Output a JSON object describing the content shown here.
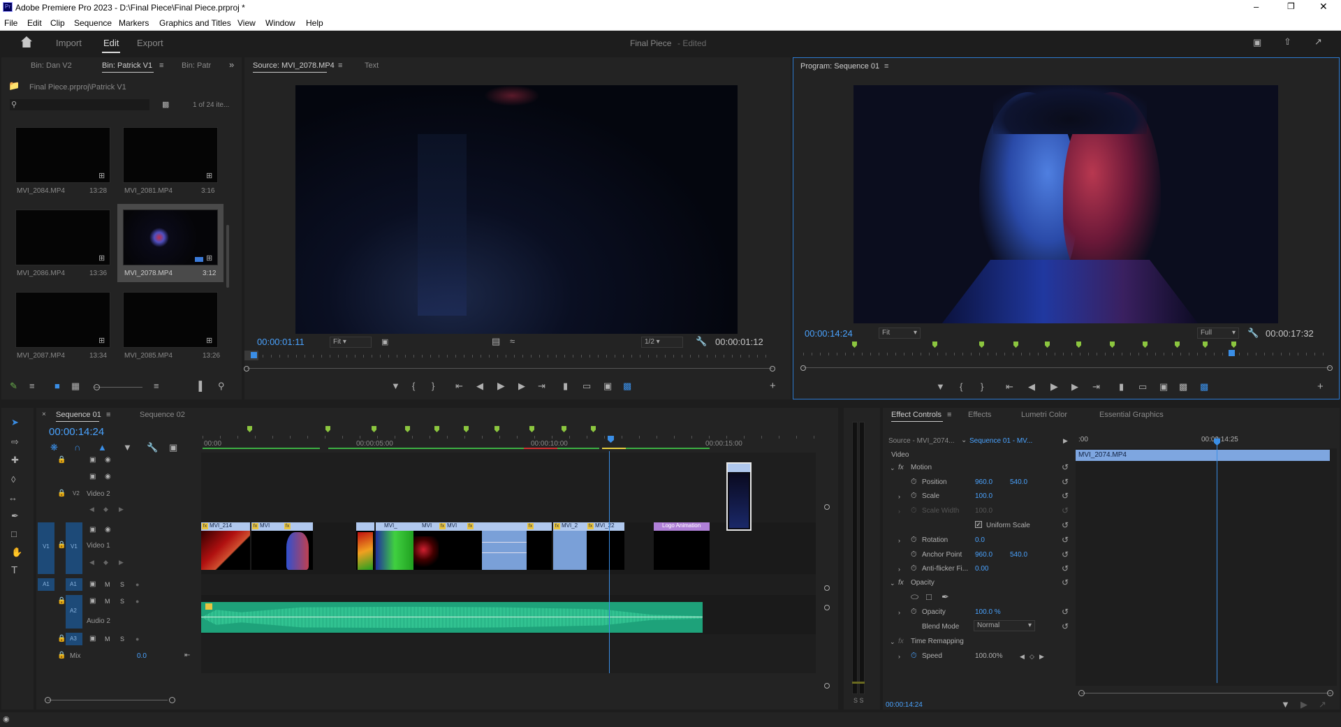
{
  "window": {
    "title": "Adobe Premiere Pro 2023 - D:\\Final Piece\\Final Piece.prproj *"
  },
  "menu": [
    "File",
    "Edit",
    "Clip",
    "Sequence",
    "Markers",
    "Graphics and Titles",
    "View",
    "Window",
    "Help"
  ],
  "workspace": {
    "tabs": [
      "Import",
      "Edit",
      "Export"
    ],
    "active": "Edit",
    "project_title": "Final Piece",
    "project_status": "- Edited"
  },
  "project_panel": {
    "tabs": [
      "Bin: Dan V2",
      "Bin: Patrick V1",
      "Bin: Patr"
    ],
    "path": "Final Piece.prproj\\Patrick V1",
    "count": "1 of 24 ite...",
    "items": [
      {
        "name": "MVI_2084.MP4",
        "duration": "13:28"
      },
      {
        "name": "MVI_2081.MP4",
        "duration": "3:16"
      },
      {
        "name": "MVI_2086.MP4",
        "duration": "13:36"
      },
      {
        "name": "MVI_2078.MP4",
        "duration": "3:12"
      },
      {
        "name": "MVI_2087.MP4",
        "duration": "13:34"
      },
      {
        "name": "MVI_2085.MP4",
        "duration": "13:26"
      }
    ]
  },
  "source_monitor": {
    "tabs": [
      "Source: MVI_2078.MP4",
      "Text"
    ],
    "timecode": "00:00:01:11",
    "fit": "Fit",
    "resolution": "1/2",
    "duration": "00:00:01:12"
  },
  "program_monitor": {
    "tab": "Program: Sequence 01",
    "timecode": "00:00:14:24",
    "fit": "Fit",
    "resolution": "Full",
    "duration": "00:00:17:32"
  },
  "timeline": {
    "tabs": [
      "Sequence 01",
      "Sequence 02"
    ],
    "timecode": "00:00:14:24",
    "ruler": [
      "00:00",
      "00:00:05:00",
      "00:00:10:00",
      "00:00:15:00"
    ],
    "tracks": {
      "v3": "V3",
      "v2": "V2",
      "v2_name": "Video 2",
      "v1": "V1",
      "v1_name": "Video 1",
      "a1": "A1",
      "a2": "A2",
      "a2_name": "Audio 2",
      "a3": "A3",
      "mix": "Mix",
      "mix_val": "0.0"
    },
    "clips": [
      "MVI_214",
      "MVI",
      "MVI_",
      "MVI",
      "MVI",
      "MVI_2",
      "MVI_22",
      "Logo Animation"
    ]
  },
  "effect_controls": {
    "tabs": [
      "Effect Controls",
      "Effects",
      "Lumetri Color",
      "Essential Graphics"
    ],
    "source": "Source - MVI_2074...",
    "sequence": "Sequence 01 - MV...",
    "clip_name": "MVI_2074.MP4",
    "ruler_left": ":00",
    "ruler_time": "00:00:14:25",
    "video": "Video",
    "motion": "Motion",
    "position": {
      "label": "Position",
      "x": "960.0",
      "y": "540.0"
    },
    "scale": {
      "label": "Scale",
      "v": "100.0"
    },
    "scale_width": {
      "label": "Scale Width",
      "v": "100.0"
    },
    "uniform": "Uniform Scale",
    "rotation": {
      "label": "Rotation",
      "v": "0.0"
    },
    "anchor": {
      "label": "Anchor Point",
      "x": "960.0",
      "y": "540.0"
    },
    "antiflicker": {
      "label": "Anti-flicker Fi...",
      "v": "0.00"
    },
    "opacity_hdr": "Opacity",
    "opacity": {
      "label": "Opacity",
      "v": "100.0 %"
    },
    "blend": {
      "label": "Blend Mode",
      "v": "Normal"
    },
    "time_remap": "Time Remapping",
    "speed": {
      "label": "Speed",
      "v": "100.00%"
    },
    "footer_tc": "00:00:14:24"
  },
  "audio_meter": {
    "label": "S S"
  }
}
